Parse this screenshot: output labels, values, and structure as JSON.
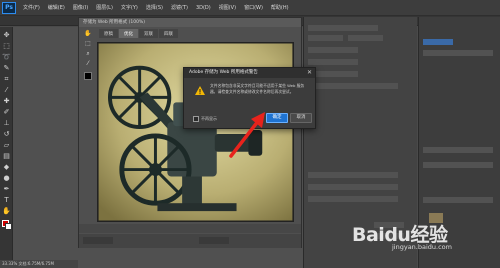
{
  "menubar": {
    "items": [
      "文件(F)",
      "编辑(E)",
      "图像(I)",
      "图层(L)",
      "文字(Y)",
      "选择(S)",
      "滤镜(T)",
      "3D(D)",
      "视图(V)",
      "窗口(W)",
      "帮助(H)"
    ]
  },
  "save_for_web": {
    "title": "存储为 Web 所用格式 (100%)",
    "tabs": [
      "原稿",
      "优化",
      "双联",
      "四联"
    ],
    "zoom": "100%"
  },
  "alert": {
    "title": "Adobe 存储为 Web 所用格式警告",
    "close_glyph": "✕",
    "message": "文件名称包含非英文字符且可能不适用于某些 Web 服务器，请检查文件名称或修改文件名称后再次尝试。",
    "checkbox_label": "不再显示",
    "ok_label": "确定",
    "cancel_label": "取消",
    "icon": "warning-icon"
  },
  "status": {
    "zoom_text": "33.33%  文档:6.75M/6.75M"
  },
  "watermark": {
    "brand": "Baidu经验",
    "url": "jingyan.baidu.com"
  },
  "colors": {
    "accent": "#1f73d1",
    "arrow": "#e8231c",
    "warning": "#f2b705"
  }
}
